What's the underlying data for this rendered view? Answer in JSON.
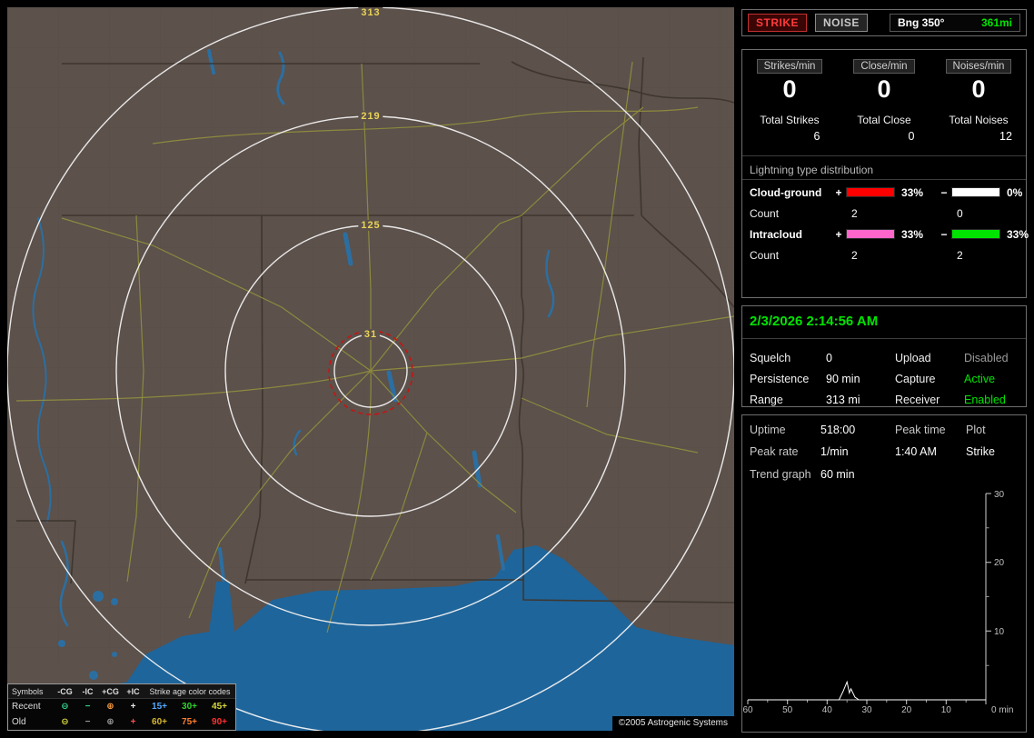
{
  "colors": {
    "green": "#00e400",
    "red": "#ff3a3a",
    "gray": "#9a9a9a"
  },
  "toolbar": {
    "strike_label": "STRIKE",
    "noise_label": "NOISE",
    "bearing_label": "Bng 350°",
    "bearing_value": "361mi"
  },
  "stats": {
    "columns": [
      {
        "header": "Strikes/min",
        "rate": "0",
        "total_label": "Total Strikes",
        "total_value": "6"
      },
      {
        "header": "Close/min",
        "rate": "0",
        "total_label": "Total Close",
        "total_value": "0"
      },
      {
        "header": "Noises/min",
        "rate": "0",
        "total_label": "Total Noises",
        "total_value": "12"
      }
    ],
    "distribution": {
      "title": "Lightning type distribution",
      "plus_sign": "+",
      "minus_sign": "−",
      "count_label": "Count",
      "rows": [
        {
          "label": "Cloud-ground",
          "plus_color": "#ff0000",
          "plus_pct": "33%",
          "minus_color": "#ffffff",
          "minus_pct": "0%",
          "plus_count": "2",
          "minus_count": "0"
        },
        {
          "label": "Intracloud",
          "plus_color": "#ff66cc",
          "plus_pct": "33%",
          "minus_color": "#00e400",
          "minus_pct": "33%",
          "plus_count": "2",
          "minus_count": "2"
        }
      ]
    }
  },
  "status": {
    "datetime": "2/3/2026 2:14:56 AM",
    "rows": [
      {
        "label": "Squelch",
        "value": "0",
        "label2": "Upload",
        "value2": "Disabled",
        "value2_color": "#9a9a9a"
      },
      {
        "label": "Persistence",
        "value": "90 min",
        "label2": "Capture",
        "value2": "Active",
        "value2_color": "#00e400"
      },
      {
        "label": "Range",
        "value": "313 mi",
        "label2": "Receiver",
        "value2": "Enabled",
        "value2_color": "#00e400"
      }
    ]
  },
  "trend": {
    "uptime_label": "Uptime",
    "uptime_value": "518:00",
    "peak_time_label": "Peak time",
    "plot_label": "Plot",
    "peak_rate_label": "Peak rate",
    "peak_rate_value": "1/min",
    "peak_time_value": "1:40 AM",
    "plot_value": "Strike",
    "graph_label": "Trend graph",
    "graph_window": "60 min",
    "chart": {
      "type": "line",
      "x_ticks": [
        "60",
        "50",
        "40",
        "30",
        "20",
        "10"
      ],
      "x_end_label": "0 min",
      "y_ticks": [
        "30",
        "20",
        "10"
      ],
      "x_range_minutes_ago": [
        60,
        0
      ],
      "y_range": [
        0,
        30
      ],
      "series": [
        {
          "name": "Strikes per minute",
          "points": [
            [
              60,
              0
            ],
            [
              40,
              0
            ],
            [
              37,
              0
            ],
            [
              36,
              1.2
            ],
            [
              35,
              2.6
            ],
            [
              34.4,
              1.0
            ],
            [
              34,
              1.6
            ],
            [
              33,
              0.4
            ],
            [
              32,
              0
            ],
            [
              0,
              0
            ]
          ]
        }
      ]
    }
  },
  "map": {
    "ring_labels": [
      "313",
      "219",
      "125",
      "31"
    ],
    "copyright": "©2005 Astrogenic Systems",
    "legend": {
      "symbols_header": "Symbols",
      "symbol_cols": [
        "-CG",
        "-IC",
        "+CG",
        "+IC"
      ],
      "age_header": "Strike age color codes",
      "rows": [
        {
          "label": "Recent",
          "symbols": [
            {
              "glyph": "⊖",
              "color": "#35d08a"
            },
            {
              "glyph": "−",
              "color": "#35d08a"
            },
            {
              "glyph": "⊕",
              "color": "#ffa040"
            },
            {
              "glyph": "+",
              "color": "#e8e8e8"
            }
          ],
          "ages": [
            {
              "text": "15+",
              "color": "#55aaff"
            },
            {
              "text": "30+",
              "color": "#2fd22f"
            },
            {
              "text": "45+",
              "color": "#d8d840"
            }
          ]
        },
        {
          "label": "Old",
          "symbols": [
            {
              "glyph": "⊖",
              "color": "#d8d840"
            },
            {
              "glyph": "−",
              "color": "#9a9a9a"
            },
            {
              "glyph": "⊕",
              "color": "#9a9a9a"
            },
            {
              "glyph": "+",
              "color": "#ff5050"
            }
          ],
          "ages": [
            {
              "text": "60+",
              "color": "#d8b830"
            },
            {
              "text": "75+",
              "color": "#ff8030"
            },
            {
              "text": "90+",
              "color": "#ff3030"
            }
          ]
        }
      ]
    }
  }
}
